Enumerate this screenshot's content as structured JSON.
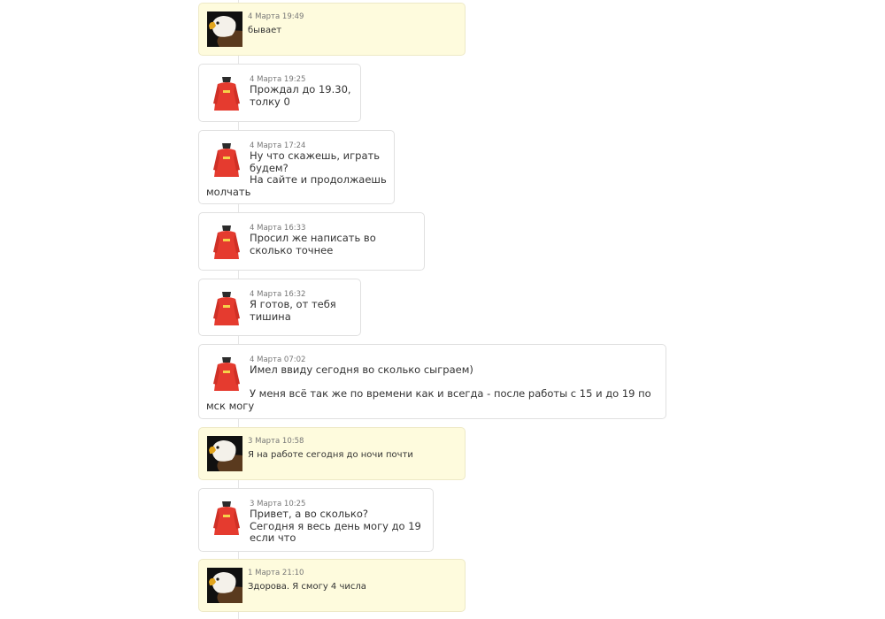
{
  "messages": [
    {
      "author": "self",
      "avatar": "eagle-icon",
      "time": "4 Марта 19:49",
      "lines": [
        "бывает"
      ]
    },
    {
      "author": "other",
      "avatar": "red-shirt-icon",
      "time": "4 Марта 19:25",
      "lines": [
        "Прождал до 19.30,",
        "толку 0"
      ]
    },
    {
      "author": "other",
      "avatar": "red-shirt-icon",
      "time": "4 Марта 17:24",
      "lines": [
        "Ну что скажешь, играть",
        "будем?",
        "На сайте и продолжаешь",
        "молчать"
      ]
    },
    {
      "author": "other",
      "avatar": "red-shirt-icon",
      "time": "4 Марта 16:33",
      "lines": [
        "Просил же написать во",
        "сколько точнее"
      ]
    },
    {
      "author": "other",
      "avatar": "red-shirt-icon",
      "time": "4 Марта 16:32",
      "lines": [
        "Я готов, от тебя",
        "тишина"
      ]
    },
    {
      "author": "other",
      "avatar": "red-shirt-icon",
      "time": "4 Марта 07:02",
      "lines": [
        "Имел ввиду сегодня во сколько сыграем)",
        "",
        "У меня всё так же по времени как и всегда - после работы с 15 и до 19 по",
        "мск могу"
      ]
    },
    {
      "author": "self",
      "avatar": "eagle-icon",
      "time": "3 Марта 10:58",
      "lines": [
        "Я на работе сегодня до ночи почти"
      ]
    },
    {
      "author": "other",
      "avatar": "red-shirt-icon",
      "time": "3 Марта 10:25",
      "lines": [
        "Привет, а во сколько?",
        "Сегодня я весь день могу до 19",
        "если что"
      ]
    },
    {
      "author": "self",
      "avatar": "eagle-icon",
      "time": "1 Марта 21:10",
      "lines": [
        "Здорова. Я смогу 4 числа"
      ]
    }
  ]
}
